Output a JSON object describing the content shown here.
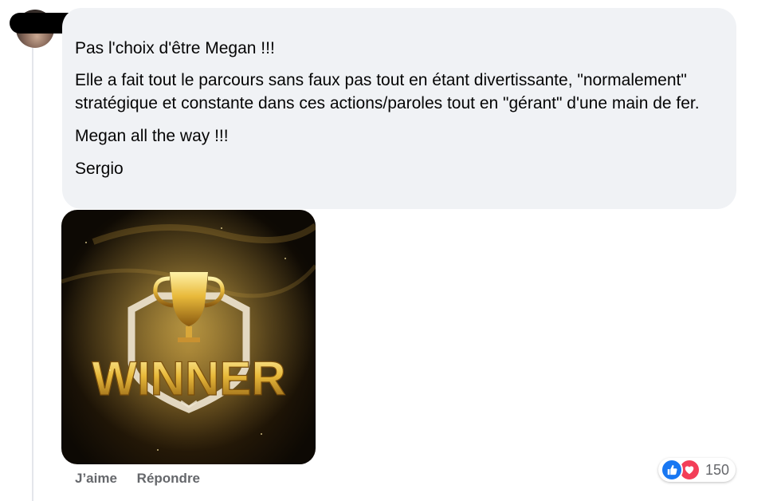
{
  "comment": {
    "paragraphs": [
      "Pas l'choix d'être Megan !!!",
      "Elle a fait tout le parcours sans faux pas tout en étant divertissante, \"normalement\" stratégique et constante dans ces actions/paroles tout en \"gérant\" d'une main de fer.",
      "Megan all the way !!!",
      "Sergio"
    ],
    "attachment": {
      "type": "gif",
      "text": "WINNER",
      "icon": "trophy-icon"
    }
  },
  "actions": {
    "like_label": "J’aime",
    "reply_label": "Répondre"
  },
  "reactions": {
    "icons": [
      "like-icon",
      "love-icon"
    ],
    "count": "150"
  },
  "colors": {
    "bubble_bg": "#f0f2f5",
    "like_blue": "#1877f2",
    "love_red": "#f33e58",
    "gold": "#e8b93a"
  }
}
